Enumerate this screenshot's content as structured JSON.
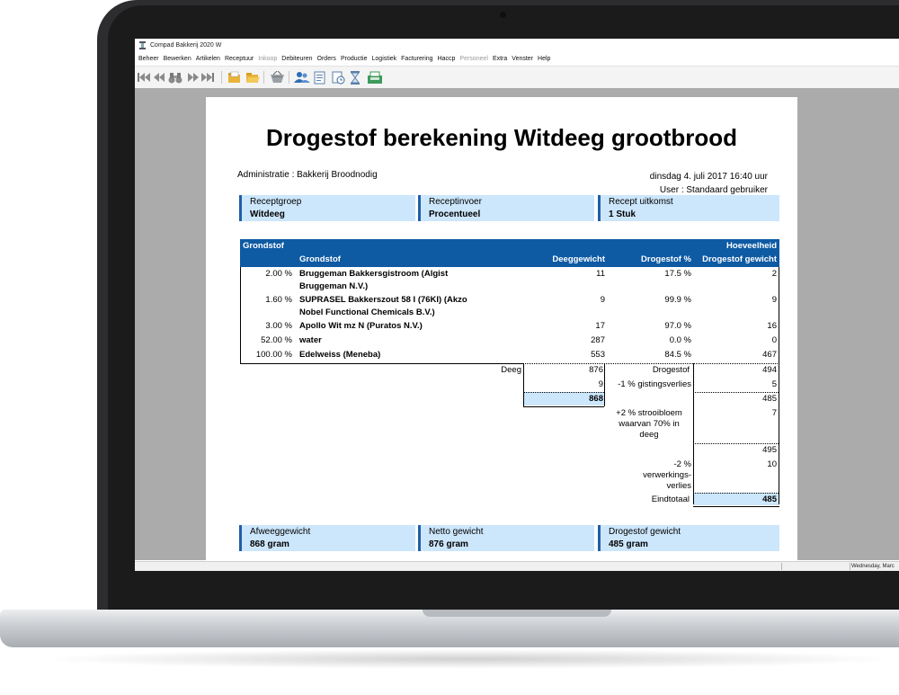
{
  "window": {
    "title": "Compad Bakkerij 2020 W"
  },
  "menu": [
    "Beheer",
    "Bewerken",
    "Artikelen",
    "Receptuur",
    "Inkoop",
    "Debiteuren",
    "Orders",
    "Productie",
    "Logistiek",
    "Facturering",
    "Haccp",
    "Personeel",
    "Extra",
    "Venster",
    "Help"
  ],
  "menu_disabled": [
    "Inkoop",
    "Personeel"
  ],
  "toolbar_icons": [
    "first-record-icon",
    "previous-record-icon",
    "search-binoculars-icon",
    "next-record-icon",
    "last-record-icon",
    "folder-icon",
    "folder-open-icon",
    "basket-icon",
    "users-icon",
    "document-icon",
    "calendar-clock-icon",
    "hourglass-icon",
    "cash-register-icon"
  ],
  "statusbar": {
    "date": "Wednesday, Marc"
  },
  "report": {
    "title": "Drogestof berekening Witdeeg grootbrood",
    "administratie": "Administratie : Bakkerij Broodnodig",
    "datetime": "dinsdag 4. juli 2017  16:40 uur",
    "user": "User :  Standaard gebruiker",
    "info_top": [
      {
        "label": "Receptgroep",
        "value": "Witdeeg"
      },
      {
        "label": "Receptinvoer",
        "value": "Procentueel"
      },
      {
        "label": "Recept uitkomst",
        "value": "1 Stuk"
      }
    ],
    "table_header": {
      "group": "Grondstof",
      "quantity": "Hoeveelheid",
      "col_grondstof": "Grondstof",
      "col_deeggewicht": "Deeggewicht",
      "col_drogestof_pct": "Drogestof %",
      "col_drogestof_gewicht": "Drogestof gewicht"
    },
    "rows": [
      {
        "pct": "2.00 %",
        "name1": "Bruggeman Bakkersgistroom (Algist",
        "name2": "Bruggeman N.V.)",
        "deeg": "11",
        "ds_pct": "17.5 %",
        "ds_gew": "2"
      },
      {
        "pct": "1.60 %",
        "name1": "SUPRASEL Bakkerszout 58 I (76KI) (Akzo",
        "name2": "Nobel Functional Chemicals B.V.)",
        "deeg": "9",
        "ds_pct": "99.9 %",
        "ds_gew": "9"
      },
      {
        "pct": "3.00 %",
        "name1": "Apollo Wit mz N (Puratos N.V.)",
        "name2": "",
        "deeg": "17",
        "ds_pct": "97.0 %",
        "ds_gew": "16"
      },
      {
        "pct": "52.00 %",
        "name1": "water",
        "name2": "",
        "deeg": "287",
        "ds_pct": "0.0 %",
        "ds_gew": "0"
      },
      {
        "pct": "100.00 %",
        "name1": "Edelweiss (Meneba)",
        "name2": "",
        "deeg": "553",
        "ds_pct": "84.5 %",
        "ds_gew": "467"
      }
    ],
    "summary": {
      "deeg_label": "Deeg",
      "deeg_value": "876",
      "gisting_value": "9",
      "netto_value": "868",
      "drogestof_label": "Drogestof",
      "drogestof_value": "494",
      "gisting_label": "-1 % gistingsverlies",
      "gisting_ds": "5",
      "sub1": "485",
      "strooi_label": "+2 % strooibloem waarvan 70% in deeg",
      "strooi_value": "7",
      "sub2": "495",
      "verwerk_label": "-2 % verwerkings-verlies",
      "verwerk_value": "10",
      "eindtotaal_label": "Eindtotaal",
      "eindtotaal_value": "485"
    },
    "info_bottom": [
      {
        "label": "Afweeggewicht",
        "value": "868 gram"
      },
      {
        "label": "Netto gewicht",
        "value": "876 gram"
      },
      {
        "label": "Drogestof gewicht",
        "value": "485 gram"
      }
    ]
  }
}
